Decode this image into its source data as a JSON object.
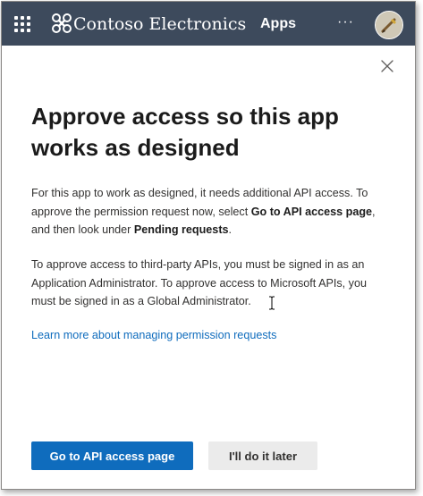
{
  "header": {
    "app_name": "Contoso Electronics",
    "apps_label": "Apps",
    "more_label": "···",
    "waffle_icon": "app-launcher-icon",
    "logo_icon": "contoso-logo-icon",
    "background_color": "#3d4a5c"
  },
  "dialog": {
    "close_icon": "close-icon",
    "title": "Approve access so this app works as designed",
    "paragraph1": {
      "part1": "For this app to work as designed, it needs additional API access. To approve the permission request now, select ",
      "bold1": "Go to API access page",
      "part2": ", and then look under ",
      "bold2": "Pending requests",
      "part3": "."
    },
    "paragraph2": "To approve access to third-party APIs, you must be signed in as an Application Administrator. To approve access to Microsoft APIs, you must be signed in as a Global Administrator.",
    "learn_more_link": "Learn more about managing permission requests",
    "primary_button": "Go to API access page",
    "secondary_button": "I'll do it later",
    "accent_color": "#0f6cbd"
  }
}
